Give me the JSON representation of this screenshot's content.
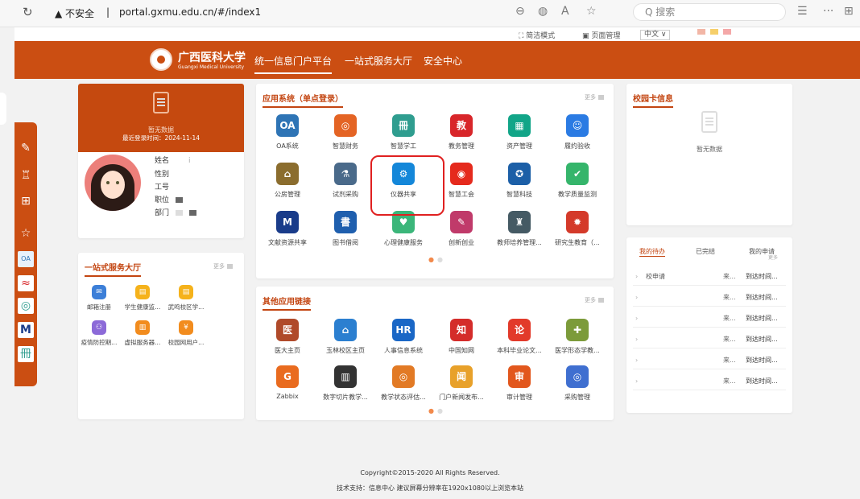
{
  "browser": {
    "security": "▲ 不安全",
    "divider": "|",
    "url": "portal.gxmu.edu.cn/#/index1",
    "search": "Q 搜索"
  },
  "topbar": {
    "simple": "简洁模式",
    "page_mgmt": "页面管理",
    "lang": "中文 ∨"
  },
  "header": {
    "school_cn": "广西医科大学",
    "school_en": "Guangxi Medical University",
    "nav": [
      "统一信息门户平台",
      "一站式服务大厅",
      "安全中心"
    ]
  },
  "user": {
    "no_data": "暂无数据",
    "last_login": "最近登录时间：2024-11-14",
    "fields": [
      "姓名",
      "性别",
      "工号",
      "职位",
      "部门"
    ]
  },
  "apps": {
    "title": "应用系统（单点登录）",
    "more": "更多",
    "items": [
      {
        "label": "OA系统",
        "icon": "OA",
        "color": "#2e74b5",
        "icon_name": "oa-icon"
      },
      {
        "label": "智慧财务",
        "icon": "◎",
        "color": "#e46424",
        "icon_name": "finance-icon"
      },
      {
        "label": "智慧学工",
        "icon": "冊",
        "color": "#2f9d8f",
        "icon_name": "student-affairs-icon"
      },
      {
        "label": "教务管理",
        "icon": "教",
        "color": "#d8262a",
        "icon_name": "academic-affairs-icon"
      },
      {
        "label": "资产管理",
        "icon": "▦",
        "color": "#12a588",
        "icon_name": "asset-icon"
      },
      {
        "label": "履约验收",
        "icon": "☺",
        "color": "#2b7be3",
        "icon_name": "acceptance-icon"
      },
      {
        "label": "公房管理",
        "icon": "⌂",
        "color": "#8b6d2e",
        "icon_name": "housing-icon"
      },
      {
        "label": "试剂采购",
        "icon": "⚗",
        "color": "#4a6a8a",
        "icon_name": "reagent-icon"
      },
      {
        "label": "仪器共享",
        "icon": "⚙",
        "color": "#1487d9",
        "icon_name": "instrument-icon"
      },
      {
        "label": "智慧工会",
        "icon": "◉",
        "color": "#e52a1d",
        "icon_name": "union-icon"
      },
      {
        "label": "智慧科技",
        "icon": "✪",
        "color": "#1c5fa7",
        "icon_name": "technology-icon"
      },
      {
        "label": "教学质量监测",
        "icon": "✔",
        "color": "#35b56b",
        "icon_name": "quality-icon"
      },
      {
        "label": "文献资源共享",
        "icon": "M",
        "color": "#1a3c8a",
        "icon_name": "literature-icon"
      },
      {
        "label": "图书借阅",
        "icon": "書",
        "color": "#1f5fae",
        "icon_name": "library-icon"
      },
      {
        "label": "心理健康服务",
        "icon": "♥",
        "color": "#3bb67a",
        "icon_name": "mental-health-icon"
      },
      {
        "label": "创新创业",
        "icon": "✎",
        "color": "#c03a6a",
        "icon_name": "innovation-icon"
      },
      {
        "label": "教师培养管理...",
        "icon": "♜",
        "color": "#455a64",
        "icon_name": "teacher-training-icon"
      },
      {
        "label": "研究生教育（...",
        "icon": "✹",
        "color": "#d43a2a",
        "icon_name": "graduate-icon"
      }
    ]
  },
  "card_info": {
    "title": "校园卡信息",
    "no_data": "暂无数据"
  },
  "service": {
    "title": "一站式服务大厅",
    "more": "更多",
    "items": [
      {
        "label": "邮箱注册",
        "icon": "✉",
        "color": "#3c7fd8",
        "icon_name": "mail-icon"
      },
      {
        "label": "学生健康监...",
        "icon": "▤",
        "color": "#f5b21b",
        "icon_name": "health-form-icon"
      },
      {
        "label": "武鸣校区学...",
        "icon": "▤",
        "color": "#f5b21b",
        "icon_name": "campus-form-icon"
      },
      {
        "label": "疫情防控期...",
        "icon": "⚇",
        "color": "#8c6ad8",
        "icon_name": "epidemic-icon"
      },
      {
        "label": "虚拟服务器...",
        "icon": "▥",
        "color": "#f28c1e",
        "icon_name": "server-icon"
      },
      {
        "label": "校园网用户...",
        "icon": "¥",
        "color": "#f28c1e",
        "icon_name": "network-user-icon"
      }
    ]
  },
  "links": {
    "title": "其他应用链接",
    "more": "更多",
    "items": [
      {
        "label": "医大主页",
        "icon": "医",
        "color": "#b04a2a",
        "icon_name": "university-home-icon"
      },
      {
        "label": "玉林校区主页",
        "icon": "⌂",
        "color": "#2b7fd0",
        "icon_name": "yulin-campus-icon"
      },
      {
        "label": "人事信息系统",
        "icon": "HR",
        "color": "#1a67c6",
        "icon_name": "hr-icon"
      },
      {
        "label": "中国知网",
        "icon": "知",
        "color": "#d42c2a",
        "icon_name": "cnki-icon"
      },
      {
        "label": "本科毕业论文...",
        "icon": "论",
        "color": "#e23a2a",
        "icon_name": "thesis-icon"
      },
      {
        "label": "医学形态学教...",
        "icon": "✚",
        "color": "#7c9b3a",
        "icon_name": "morphology-icon"
      },
      {
        "label": "Zabbix",
        "icon": "G",
        "color": "#e96b1f",
        "icon_name": "zabbix-icon"
      },
      {
        "label": "数字切片教学...",
        "icon": "▥",
        "color": "#333333",
        "icon_name": "slide-icon"
      },
      {
        "label": "教学状态评估...",
        "icon": "◎",
        "color": "#e27a25",
        "icon_name": "evaluation-icon"
      },
      {
        "label": "门户新闻发布...",
        "icon": "闻",
        "color": "#e8a12a",
        "icon_name": "news-icon"
      },
      {
        "label": "审计管理",
        "icon": "审",
        "color": "#e2571d",
        "icon_name": "audit-icon"
      },
      {
        "label": "采购管理",
        "icon": "◎",
        "color": "#3f6fd0",
        "icon_name": "procurement-icon"
      }
    ]
  },
  "todo": {
    "tabs": [
      "我的待办",
      "已完结",
      "我的申请"
    ],
    "more": "更多",
    "rows": [
      {
        "title": "校申请",
        "from": "来...",
        "date": "到达时间..."
      },
      {
        "title": "",
        "from": "来...",
        "date": "到达时间..."
      },
      {
        "title": "",
        "from": "来...",
        "date": "到达时间..."
      },
      {
        "title": "",
        "from": "来...",
        "date": "到达时间..."
      },
      {
        "title": "",
        "from": "来...",
        "date": "到达时间..."
      },
      {
        "title": "",
        "from": "来...",
        "date": "到达时间..."
      }
    ]
  },
  "footer": {
    "copyright": "Copyright©2015-2020 All Rights Reserved.",
    "support": "技术支持：信息中心 建议屏幕分辨率在1920x1080以上浏览本站"
  },
  "colors": {
    "brand": "#cb4e12",
    "highlight": "#e02020"
  }
}
